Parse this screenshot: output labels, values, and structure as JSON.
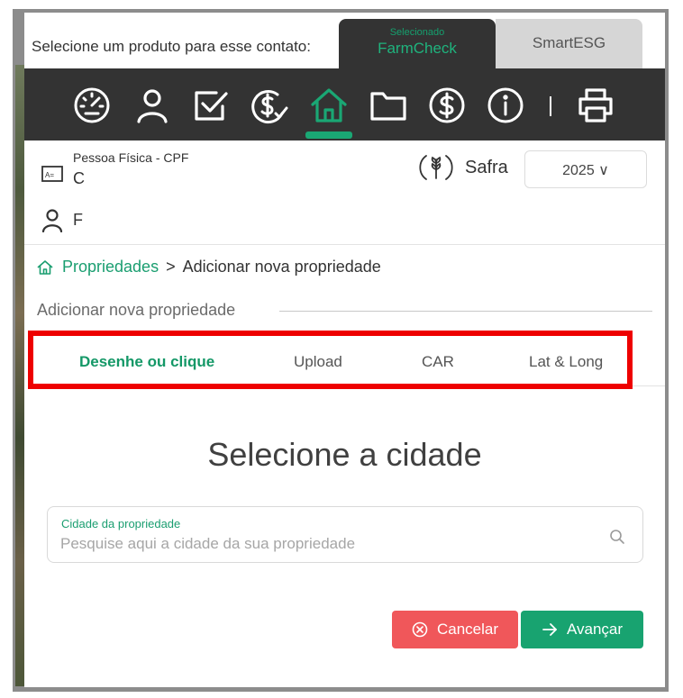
{
  "products": {
    "prompt": "Selecione um produto para esse contato:",
    "active_tab": {
      "subtitle": "Selecionado",
      "label": "FarmCheck"
    },
    "other_tab": {
      "label": "SmartESG"
    }
  },
  "toolbar": {
    "icons": [
      "dashboard-icon",
      "user-icon",
      "checklist-icon",
      "money-check-icon",
      "home-icon",
      "folder-icon",
      "dollar-icon",
      "info-icon",
      "printer-icon"
    ],
    "active": "home-icon"
  },
  "contact": {
    "person_type": "Pessoa Física - CPF",
    "name_line_1": "C",
    "name_line_2": "F",
    "safra_label": "Safra",
    "safra_year": "2025 ∨"
  },
  "breadcrumb": {
    "root": "Propriedades",
    "separator": ">",
    "current": "Adicionar nova propriedade"
  },
  "section": {
    "title": "Adicionar nova propriedade"
  },
  "mode_tabs": [
    {
      "label": "Desenhe ou clique",
      "active": true
    },
    {
      "label": "Upload",
      "active": false
    },
    {
      "label": "CAR",
      "active": false
    },
    {
      "label": "Lat & Long",
      "active": false
    }
  ],
  "city": {
    "heading": "Selecione a cidade",
    "field_label": "Cidade da propriedade",
    "placeholder": "Pesquise aqui a cidade da sua propriedade",
    "value": ""
  },
  "actions": {
    "cancel_label": "Cancelar",
    "next_label": "Avançar"
  },
  "colors": {
    "accent_green": "#18a370",
    "toolbar_bg": "#333333",
    "cancel_red": "#f0575a",
    "highlight_red": "#ee0000"
  }
}
